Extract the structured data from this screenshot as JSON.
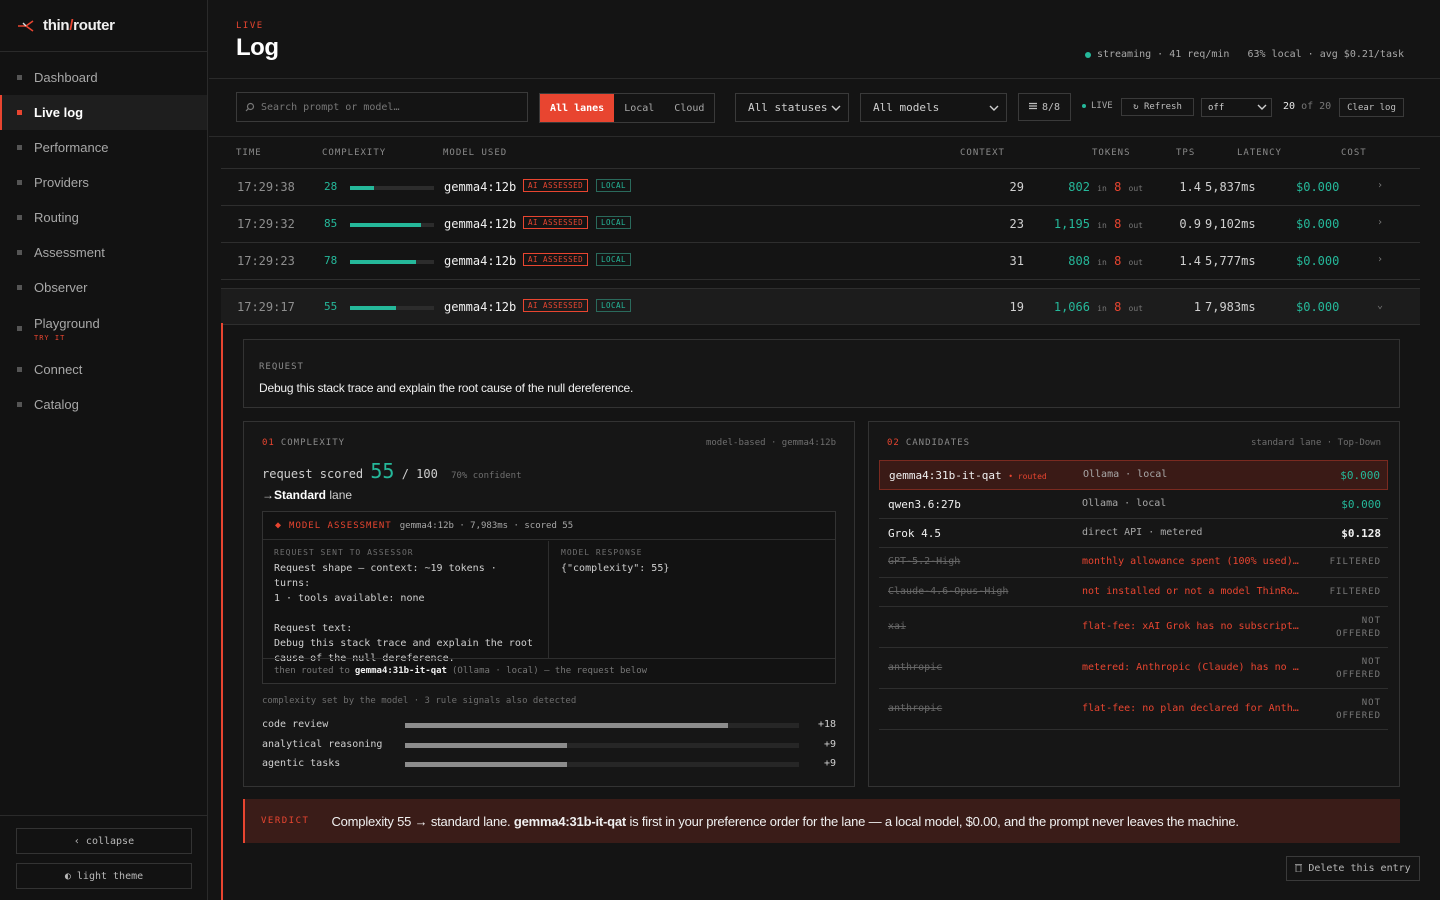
{
  "brand": {
    "prefix": "thin",
    "slash": "/",
    "suffix": "router"
  },
  "nav": {
    "dashboard": "Dashboard",
    "live_log": "Live log",
    "performance": "Performance",
    "providers": "Providers",
    "routing": "Routing",
    "assessment": "Assessment",
    "observer": "Observer",
    "playground": "Playground",
    "playground_sub": "TRY IT",
    "connect": "Connect",
    "catalog": "Catalog"
  },
  "sidebar_bottom": {
    "collapse": "‹ collapse",
    "theme": "◐ light theme"
  },
  "header": {
    "tag": "LIVE",
    "title": "Log",
    "stats": "streaming · 41 req/min   63% local · avg $0.21/task"
  },
  "toolbar": {
    "search_placeholder": "Search prompt or model…",
    "lanes": [
      "All lanes",
      "Local",
      "Cloud"
    ],
    "status_filter": "All statuses",
    "model_filter": "All models",
    "columns_btn": "8/8",
    "live_label": "LIVE",
    "refresh": "↻ Refresh",
    "interval": "off",
    "count_shown": "20",
    "count_of": "of 20",
    "clear": "Clear log"
  },
  "table": {
    "headers": {
      "time": "TIME",
      "complexity": "COMPLEXITY",
      "model": "MODEL USED",
      "context": "CONTEXT",
      "tokens": "TOKENS",
      "tps": "TPS",
      "latency": "LATENCY",
      "cost": "COST"
    },
    "tag_ai": "AI ASSESSED",
    "tag_local": "LOCAL",
    "tok_in": "in",
    "tok_out": "out",
    "rows": [
      {
        "time": "17:29:38",
        "score": "28",
        "score_pct": 28,
        "model": "gemma4:12b",
        "context": "29",
        "tokens_in": "802",
        "tokens_out": "8",
        "tps": "1.4",
        "latency": "5,837ms",
        "cost": "$0.000",
        "chev": "›"
      },
      {
        "time": "17:29:32",
        "score": "85",
        "score_pct": 85,
        "model": "gemma4:12b",
        "context": "23",
        "tokens_in": "1,195",
        "tokens_out": "8",
        "tps": "0.9",
        "latency": "9,102ms",
        "cost": "$0.000",
        "chev": "›"
      },
      {
        "time": "17:29:23",
        "score": "78",
        "score_pct": 78,
        "model": "gemma4:12b",
        "context": "31",
        "tokens_in": "808",
        "tokens_out": "8",
        "tps": "1.4",
        "latency": "5,777ms",
        "cost": "$0.000",
        "chev": "›"
      },
      {
        "time": "17:29:17",
        "score": "55",
        "score_pct": 55,
        "model": "gemma4:12b",
        "context": "19",
        "tokens_in": "1,066",
        "tokens_out": "8",
        "tps": "1",
        "latency": "7,983ms",
        "cost": "$0.000",
        "chev": "⌄"
      }
    ]
  },
  "detail": {
    "request_label": "REQUEST",
    "request_text": "Debug this stack trace and explain the root cause of the null dereference.",
    "complexity": {
      "num": "01",
      "label": "COMPLEXITY",
      "meta": "model-based · gemma4:12b",
      "scored_prefix": "request scored",
      "score": "55",
      "of": "/ 100",
      "confidence": "70% confident",
      "arrow": "→",
      "lane": "Standard",
      "lane_suffix": "lane",
      "assessment": {
        "title": "MODEL ASSESSMENT",
        "meta": "gemma4:12b · 7,983ms · scored 55",
        "sent_cap": "REQUEST SENT TO ASSESSOR",
        "sent_line1": "Request shape — context: ~19 tokens · turns:",
        "sent_line2": "1 · tools available: none",
        "sent_line3": "Request text:",
        "sent_line4": "Debug this stack trace and explain the root",
        "sent_line5": "cause of the null dereference.",
        "resp_cap": "MODEL RESPONSE",
        "resp_text": "{\"complexity\": 55}",
        "foot_prefix": "then routed to",
        "foot_model": "gemma4:31b-it-qat",
        "foot_suffix": "(Ollama · local) — the request below"
      },
      "signals_note": "complexity set by the model · 3 rule signals also detected",
      "signals": [
        {
          "name": "code review",
          "value": "+18",
          "level": 0.82
        },
        {
          "name": "analytical reasoning",
          "value": "+9",
          "level": 0.41
        },
        {
          "name": "agentic tasks",
          "value": "+9",
          "level": 0.41
        }
      ]
    },
    "candidates": {
      "num": "02",
      "label": "CANDIDATES",
      "meta": "standard lane · Top-Down",
      "routed_tag": "• routed",
      "rows": [
        {
          "name": "gemma4:31b-it-qat",
          "source": "Ollama · local",
          "price": "$0.000",
          "state": "routed"
        },
        {
          "name": "qwen3.6:27b",
          "source": "Ollama · local",
          "price": "$0.000",
          "state": "ok"
        },
        {
          "name": "Grok 4.5",
          "source": "direct API · metered",
          "price": "$0.128",
          "state": "ok"
        },
        {
          "name": "GPT-5.2-High",
          "source": "monthly allowance spent (100% used)…",
          "price": "FILTERED",
          "state": "filtered"
        },
        {
          "name": "Claude-4.6-Opus-High",
          "source": "not installed or not a model ThinRo…",
          "price": "FILTERED",
          "state": "filtered"
        },
        {
          "name": "xai",
          "source": "flat-fee: xAI Grok has no subscript…",
          "price": "NOT",
          "price2": "OFFERED",
          "state": "filtered"
        },
        {
          "name": "anthropic",
          "source": "metered: Anthropic (Claude) has no …",
          "price": "NOT",
          "price2": "OFFERED",
          "state": "filtered"
        },
        {
          "name": "anthropic",
          "source": "flat-fee: no plan declared for Anth…",
          "price": "NOT",
          "price2": "OFFERED",
          "state": "filtered"
        }
      ]
    },
    "verdict": {
      "label": "VERDICT",
      "part1": "Complexity 55 → standard lane.",
      "model": "gemma4:31b-it-qat",
      "part2": "is first in your preference order for the lane — a local model, $0.00, and the prompt never leaves the machine."
    },
    "delete": "Delete this entry"
  },
  "colors": {
    "accent": "#e84530",
    "green": "#25b89a",
    "bg": "#141414"
  }
}
